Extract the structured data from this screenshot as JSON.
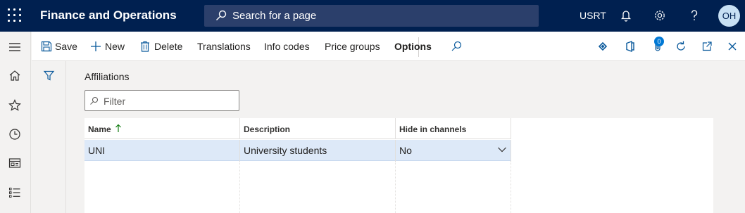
{
  "topbar": {
    "app_title": "Finance and Operations",
    "search_placeholder": "Search for a page",
    "company": "USRT",
    "user_initials": "OH",
    "icons": [
      "waffle-icon",
      "search-icon",
      "bell-icon",
      "gear-icon",
      "help-icon"
    ]
  },
  "leftnav": {
    "icons": [
      "hamburger-icon",
      "home-icon",
      "star-icon",
      "clock-icon",
      "workspace-icon",
      "list-icon"
    ]
  },
  "actions": {
    "save": "Save",
    "new": "New",
    "delete": "Delete",
    "translations": "Translations",
    "info_codes": "Info codes",
    "price_groups": "Price groups",
    "options": "Options",
    "attachments_count": "0"
  },
  "main": {
    "section_title": "Affiliations",
    "filter_placeholder": "Filter",
    "columns": [
      "Name",
      "Description",
      "Hide in channels"
    ],
    "rows": [
      {
        "name": "UNI",
        "description": "University students",
        "hide_in_channels": "No"
      }
    ]
  },
  "colors": {
    "topbar": "#002050",
    "accent": "#0078d4",
    "selected_row": "#dde9f8"
  }
}
